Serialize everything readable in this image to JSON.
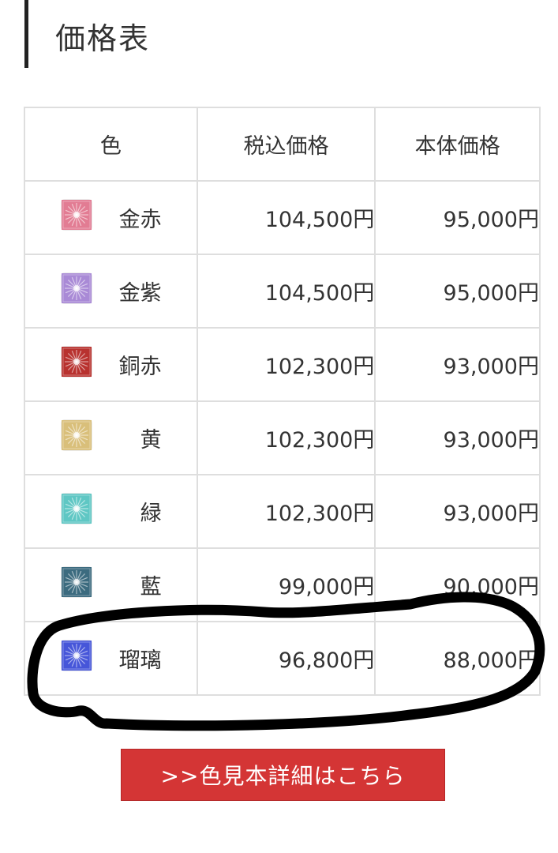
{
  "heading": "価格表",
  "table": {
    "headers": [
      "色",
      "税込価格",
      "本体価格"
    ],
    "rows": [
      {
        "name": "金赤",
        "tax_price": "104,500円",
        "base_price": "95,000円",
        "swatch_color": "#e27c93"
      },
      {
        "name": "金紫",
        "tax_price": "104,500円",
        "base_price": "95,000円",
        "swatch_color": "#a98ad6"
      },
      {
        "name": "銅赤",
        "tax_price": "102,300円",
        "base_price": "93,000円",
        "swatch_color": "#b8322f"
      },
      {
        "name": "黄",
        "tax_price": "102,300円",
        "base_price": "93,000円",
        "swatch_color": "#d9bf7a"
      },
      {
        "name": "緑",
        "tax_price": "102,300円",
        "base_price": "93,000円",
        "swatch_color": "#5fc7c4"
      },
      {
        "name": "藍",
        "tax_price": "99,000円",
        "base_price": "90,000円",
        "swatch_color": "#3c6b7f"
      },
      {
        "name": "瑠璃",
        "tax_price": "96,800円",
        "base_price": "88,000円",
        "swatch_color": "#4656d9"
      }
    ]
  },
  "button": {
    "label": ">>色見本詳細はこちら",
    "color": "#d43535"
  }
}
